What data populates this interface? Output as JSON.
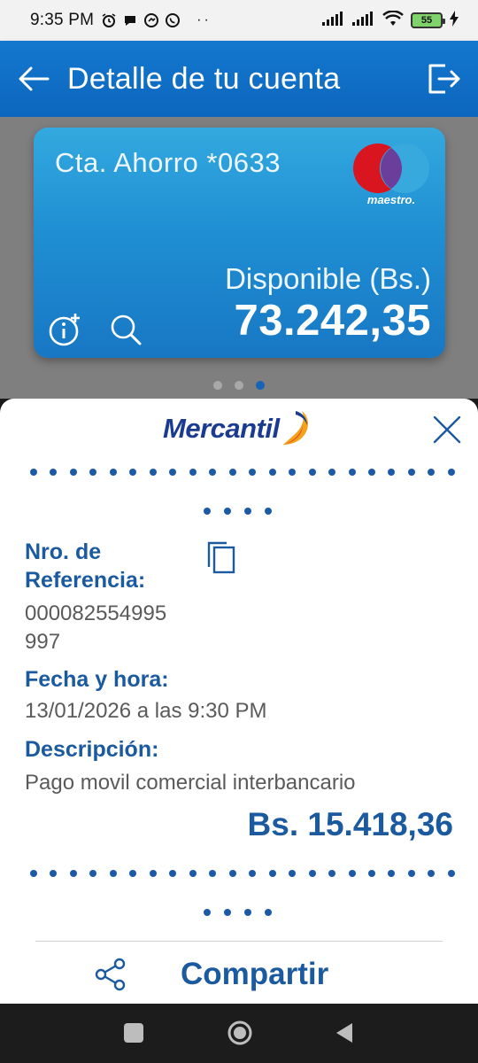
{
  "status_bar": {
    "time": "9:35 PM",
    "battery": "55"
  },
  "app_bar": {
    "title": "Detalle de tu cuenta"
  },
  "card": {
    "account": "Cta. Ahorro *0633",
    "brand": "maestro.",
    "available_label": "Disponible (Bs.)",
    "available_amount": "73.242,35"
  },
  "pager": {
    "count": 3,
    "active_index": 2
  },
  "sheet": {
    "logo": "Mercantil",
    "reference_label": "Nro. de Referencia:",
    "reference_value_line1": "000082554995",
    "reference_value_line2": "997",
    "datetime_label": "Fecha y hora:",
    "datetime_value": "13/01/2026 a las 9:30 PM",
    "description_label": "Descripción:",
    "description_value": "Pago movil comercial interbancario",
    "amount": "Bs. 15.418,36",
    "share_label": "Compartir"
  },
  "colors": {
    "primary_blue": "#1478cf",
    "text_blue": "#1c5aa0",
    "card_top": "#33a9df",
    "card_bottom": "#1877c4"
  }
}
